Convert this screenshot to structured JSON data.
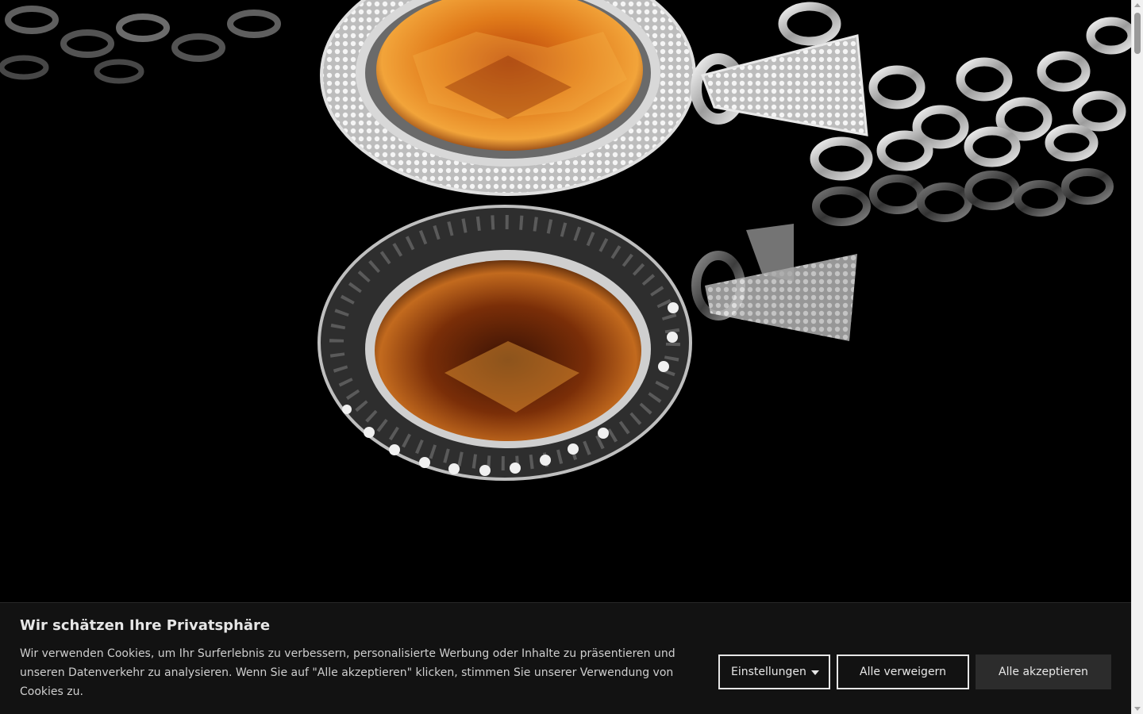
{
  "hero": {
    "image_subject": "topaz-pendant-on-chain-with-reflection"
  },
  "cookie_banner": {
    "title": "Wir schätzen Ihre Privatsphäre",
    "text": "Wir verwenden Cookies, um Ihr Surferlebnis zu verbessern, personalisierte Werbung oder Inhalte zu präsentieren und unseren Datenverkehr zu analysieren. Wenn Sie auf \"Alle akzeptieren\" klicken, stimmen Sie unserer Verwendung von Cookies zu.",
    "settings_label": "Einstellungen",
    "reject_label": "Alle verweigern",
    "accept_label": "Alle akzeptieren",
    "background_color": "#121212",
    "accept_button_color": "#2c2c2c"
  },
  "colors": {
    "page_background": "#000000",
    "gem_orange": "#e07a1a",
    "metal_silver": "#d9d9d9"
  }
}
